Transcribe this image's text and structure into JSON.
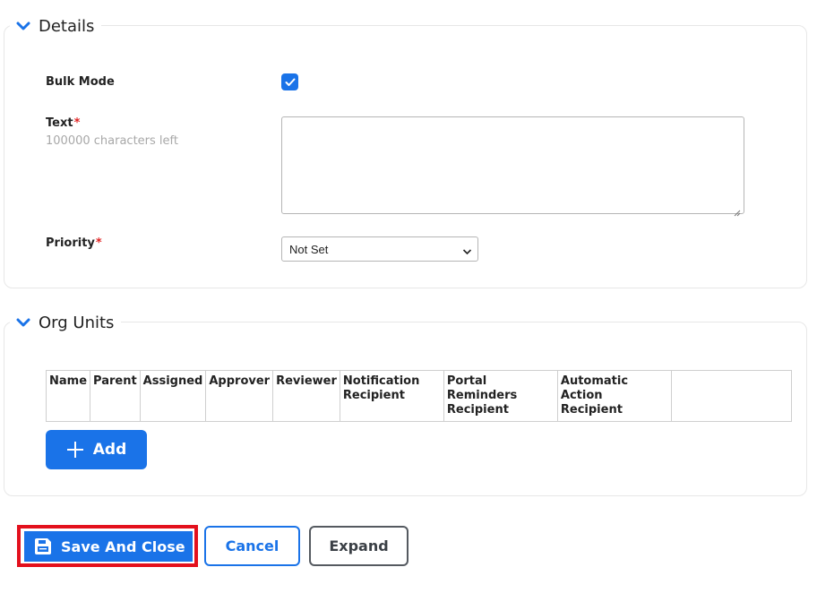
{
  "details": {
    "title": "Details",
    "bulk_mode_label": "Bulk Mode",
    "bulk_mode_checked": true,
    "text_label": "Text",
    "required_mark": "*",
    "text_hint": "100000 characters left",
    "text_value": "",
    "priority_label": "Priority",
    "priority_value": "Not Set"
  },
  "org_units": {
    "title": "Org Units",
    "columns": [
      "Name",
      "Parent",
      "Assigned",
      "Approver",
      "Reviewer",
      "Notification Recipient",
      "Portal Reminders Recipient",
      "Automatic Action Recipient",
      ""
    ],
    "add_label": "Add"
  },
  "footer": {
    "save_label": "Save And Close",
    "cancel_label": "Cancel",
    "expand_label": "Expand"
  },
  "colors": {
    "accent": "#1a73e8",
    "required": "#e02424",
    "highlight": "#e3101d"
  },
  "icons": {
    "legend": "chevron-down-icon",
    "checkbox": "check-icon",
    "add": "plus-icon",
    "save": "floppy-disk-icon",
    "select": "caret-down-icon"
  }
}
